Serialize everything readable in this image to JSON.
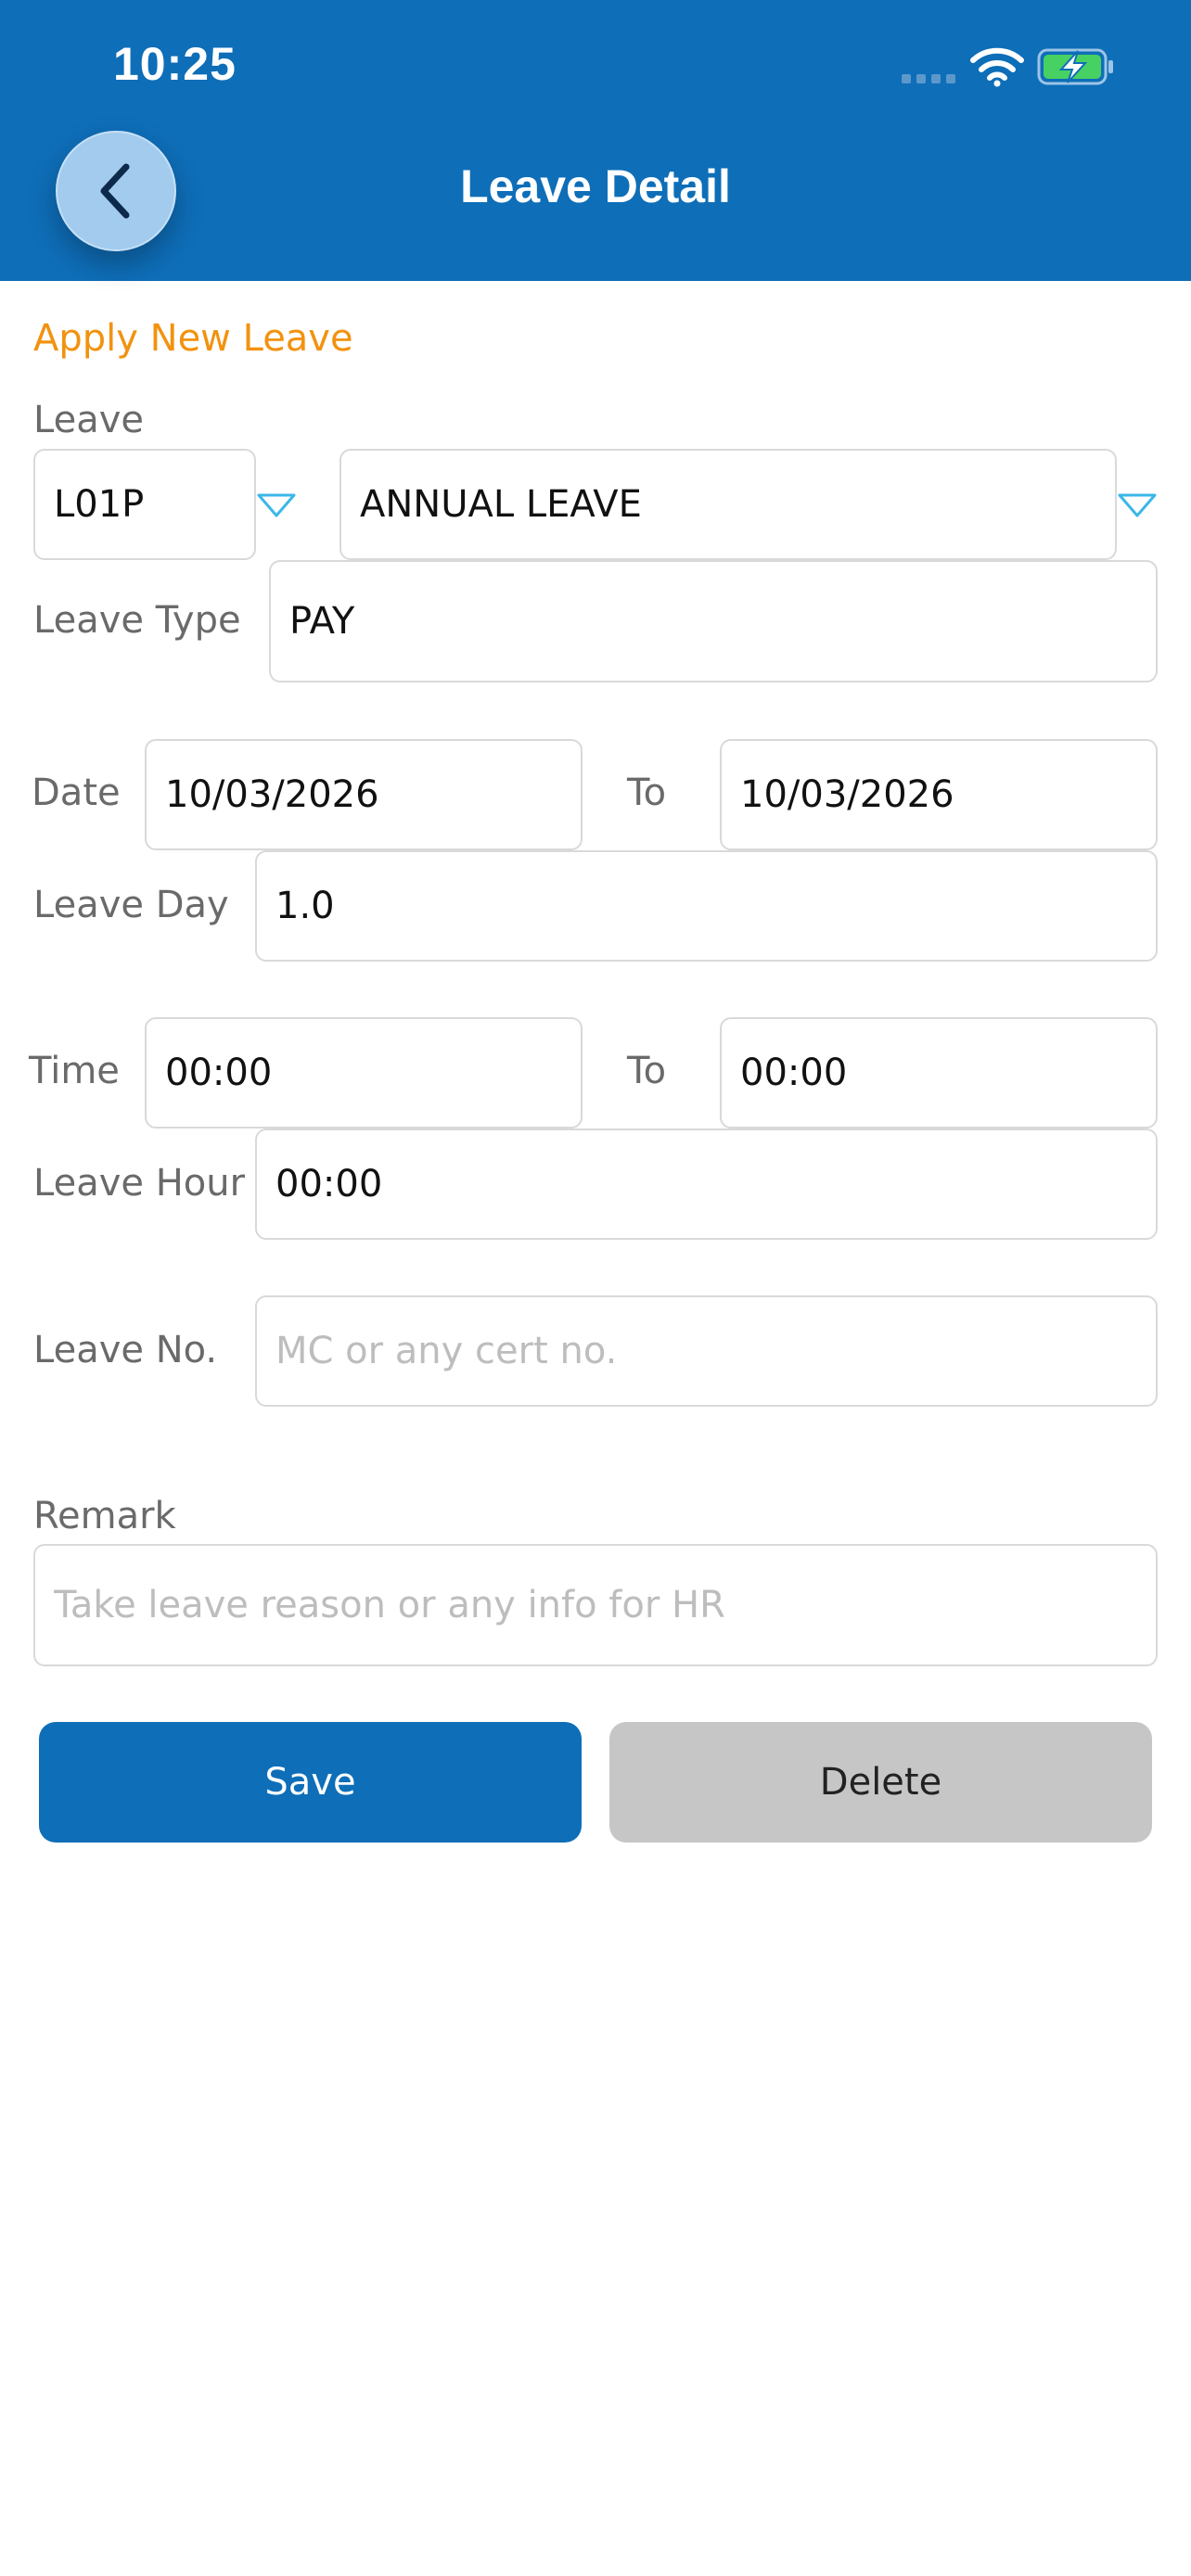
{
  "status_bar": {
    "time": "10:25"
  },
  "header": {
    "title": "Leave Detail",
    "back_icon": "chevron-left-icon",
    "background_color": "#0e6eb8"
  },
  "form": {
    "section_title": "Apply New Leave",
    "leave": {
      "label": "Leave",
      "code_value": "L01P",
      "name_value": "ANNUAL LEAVE"
    },
    "leave_type": {
      "label": "Leave Type",
      "value": "PAY"
    },
    "date": {
      "label": "Date",
      "from_value": "10/03/2026",
      "to_label": "To",
      "to_value": "10/03/2026"
    },
    "leave_day": {
      "label": "Leave Day",
      "value": "1.0"
    },
    "time": {
      "label": "Time",
      "from_value": "00:00",
      "to_label": "To",
      "to_value": "00:00"
    },
    "leave_hour": {
      "label": "Leave Hour",
      "value": "00:00"
    },
    "leave_no": {
      "label": "Leave No.",
      "value": "",
      "placeholder": "MC or any cert no."
    },
    "remark": {
      "label": "Remark",
      "value": "",
      "placeholder": "Take leave reason or any info for HR"
    }
  },
  "actions": {
    "save_label": "Save",
    "delete_label": "Delete"
  },
  "colors": {
    "accent": "#f2920f",
    "dropdown_arrow": "#3bb7e8",
    "delete_button": "#c6c6c6"
  }
}
